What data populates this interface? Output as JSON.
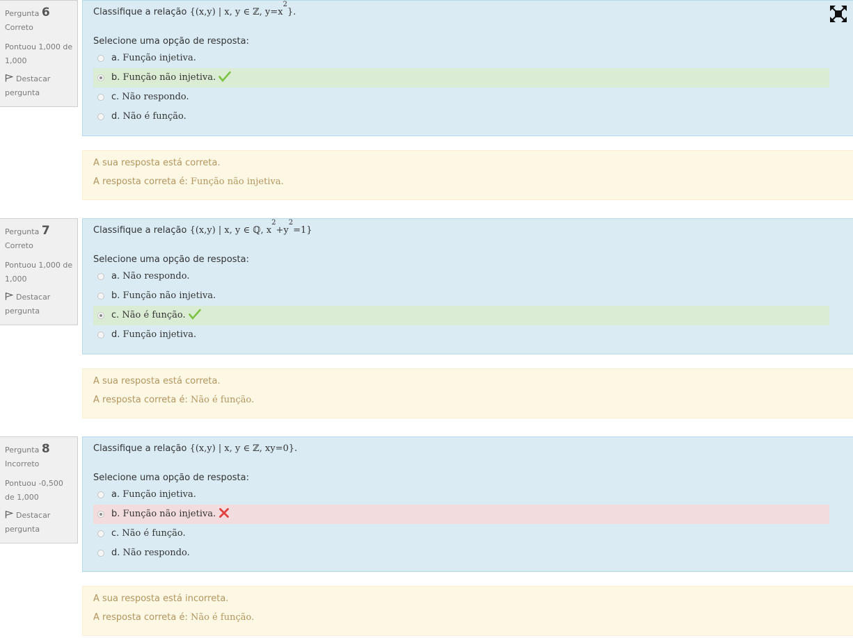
{
  "labels": {
    "question_word": "Pergunta",
    "prompt": "Selecione uma opção de resposta:",
    "flag": "Destacar pergunta",
    "right_answer_prefix": "A resposta correta é: "
  },
  "colors": {
    "info_bg": "#f0f0f0",
    "question_bg": "#daebf4",
    "correct_bg": "#dbecd4",
    "incorrect_bg": "#f2dcdd",
    "feedback_bg": "#fcf8e3",
    "feedback_text": "#b39460",
    "check_green": "#7cc243",
    "cross_red": "#e0413f"
  },
  "questions": [
    {
      "number": "6",
      "state": "Correto",
      "grade": "Pontuou 1,000 de 1,000",
      "qtext_prefix": "Classifique a relação ",
      "qtext_math": "{(x,y) | x, y ∈ ℤ, y=x",
      "qtext_sup": "2",
      "qtext_end": "}.",
      "answers": [
        {
          "letter": "a. ",
          "text": "Função injetiva.",
          "selected": false,
          "mark": "",
          "icon": ""
        },
        {
          "letter": "b. ",
          "text": "Função não injetiva.",
          "selected": true,
          "mark": "correct",
          "icon": "check-icon"
        },
        {
          "letter": "c. ",
          "text": "Não respondo.",
          "selected": false,
          "mark": "",
          "icon": ""
        },
        {
          "letter": "d. ",
          "text": "Não é função.",
          "selected": false,
          "mark": "",
          "icon": ""
        }
      ],
      "feedback": "A sua resposta está correta.",
      "right_answer": "Função não injetiva."
    },
    {
      "number": "7",
      "state": "Correto",
      "grade": "Pontuou 1,000 de 1,000",
      "qtext_prefix": "Classifique a relação ",
      "qtext_math": "{(x,y) | x, y ∈ ℚ, x",
      "qtext_sup": "2",
      "qtext_mid": "+y",
      "qtext_sup2": "2",
      "qtext_end": "=1}",
      "answers": [
        {
          "letter": "a. ",
          "text": "Não respondo.",
          "selected": false,
          "mark": "",
          "icon": ""
        },
        {
          "letter": "b. ",
          "text": "Função não injetiva.",
          "selected": false,
          "mark": "",
          "icon": ""
        },
        {
          "letter": "c. ",
          "text": "Não é função.",
          "selected": true,
          "mark": "correct",
          "icon": "check-icon"
        },
        {
          "letter": "d. ",
          "text": "Função injetiva.",
          "selected": false,
          "mark": "",
          "icon": ""
        }
      ],
      "feedback": "A sua resposta está correta.",
      "right_answer": "Não é função."
    },
    {
      "number": "8",
      "state": "Incorreto",
      "grade": "Pontuou -0,500 de 1,000",
      "qtext_prefix": "Classifique a relação ",
      "qtext_math": "{(x,y) | x, y ∈ ℤ, xy=0}.",
      "answers": [
        {
          "letter": "a. ",
          "text": "Função injetiva.",
          "selected": false,
          "mark": "",
          "icon": ""
        },
        {
          "letter": "b. ",
          "text": "Função não injetiva.",
          "selected": true,
          "mark": "incorrect",
          "icon": "cross-icon"
        },
        {
          "letter": "c. ",
          "text": "Não é função.",
          "selected": false,
          "mark": "",
          "icon": ""
        },
        {
          "letter": "d. ",
          "text": "Não respondo.",
          "selected": false,
          "mark": "",
          "icon": ""
        }
      ],
      "feedback": "A sua resposta está incorreta.",
      "right_answer": "Não é função."
    }
  ],
  "toolbar": {
    "expand_icon": "fullscreen-expand-icon"
  }
}
